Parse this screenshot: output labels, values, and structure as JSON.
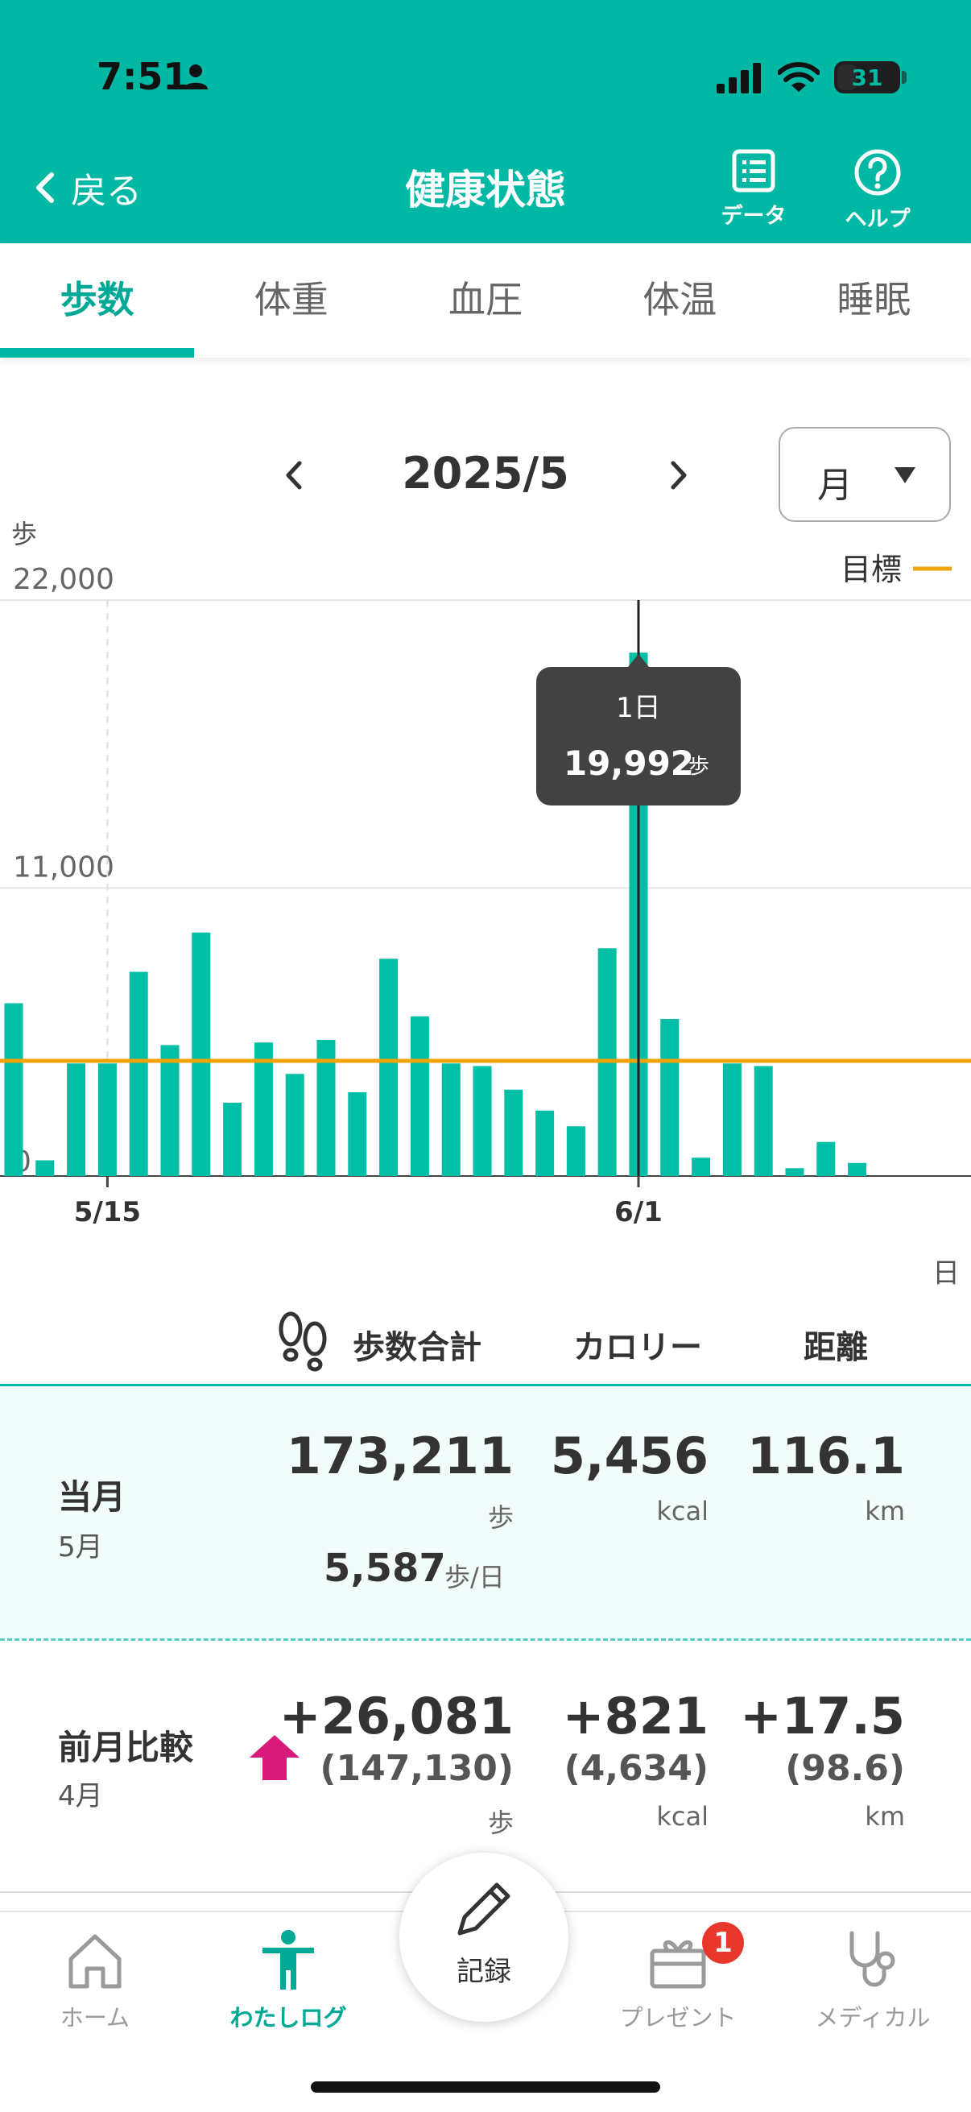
{
  "status_bar": {
    "time": "7:51",
    "battery": "31"
  },
  "header": {
    "back_label": "戻る",
    "title": "健康状態",
    "data_label": "データ",
    "help_label": "ヘルプ"
  },
  "tabs": [
    {
      "label": "歩数",
      "active": true
    },
    {
      "label": "体重",
      "active": false
    },
    {
      "label": "血圧",
      "active": false
    },
    {
      "label": "体温",
      "active": false
    },
    {
      "label": "睡眠",
      "active": false
    }
  ],
  "period": {
    "label": "2025/5",
    "range_value": "月"
  },
  "colors": {
    "accent": "#00b8a4",
    "goal": "#f0a30a",
    "bar": "#00bfa6",
    "up_arrow": "#d81b7a"
  },
  "chart_data": {
    "type": "bar",
    "y_unit": "歩",
    "x_unit": "日",
    "ylim": [
      0,
      22000
    ],
    "y_ticks": [
      {
        "value": 22000,
        "label": "22,000"
      },
      {
        "value": 11000,
        "label": "11,000"
      },
      {
        "value": 0,
        "label": "0"
      }
    ],
    "x_tick_labels": [
      {
        "label": "5/15",
        "index": 3
      },
      {
        "label": "6/1",
        "index": 20
      }
    ],
    "goal": 4400,
    "goal_label": "目標",
    "values": [
      6600,
      600,
      4300,
      4300,
      7800,
      5000,
      9300,
      2800,
      5100,
      3900,
      5200,
      3200,
      8300,
      6100,
      4300,
      4200,
      3300,
      2500,
      1900,
      8700,
      19992,
      6000,
      700,
      4300,
      4200,
      300,
      1300,
      500
    ],
    "selected_index": 20,
    "tooltip": {
      "date": "1日",
      "value": "19,992",
      "unit": "歩"
    }
  },
  "summary": {
    "headers": {
      "steps": "歩数合計",
      "calories": "カロリー",
      "distance": "距離"
    },
    "current": {
      "label": "当月",
      "sub": "5月",
      "steps": "173,211",
      "steps_unit": "歩",
      "calories": "5,456",
      "calories_unit": "kcal",
      "distance": "116.1",
      "distance_unit": "km",
      "daily": "5,587",
      "daily_unit": "歩/日"
    },
    "compare": {
      "label": "前月比較",
      "sub": "4月",
      "steps": "+26,081",
      "steps_prev": "(147,130)",
      "steps_unit": "歩",
      "calories": "+821",
      "calories_prev": "(4,634)",
      "calories_unit": "kcal",
      "distance": "+17.5",
      "distance_prev": "(98.6)",
      "distance_unit": "km"
    }
  },
  "bottom_nav": {
    "home": "ホーム",
    "mylog": "わたしログ",
    "record": "記録",
    "present": "プレゼント",
    "present_badge": "1",
    "medical": "メディカル"
  }
}
